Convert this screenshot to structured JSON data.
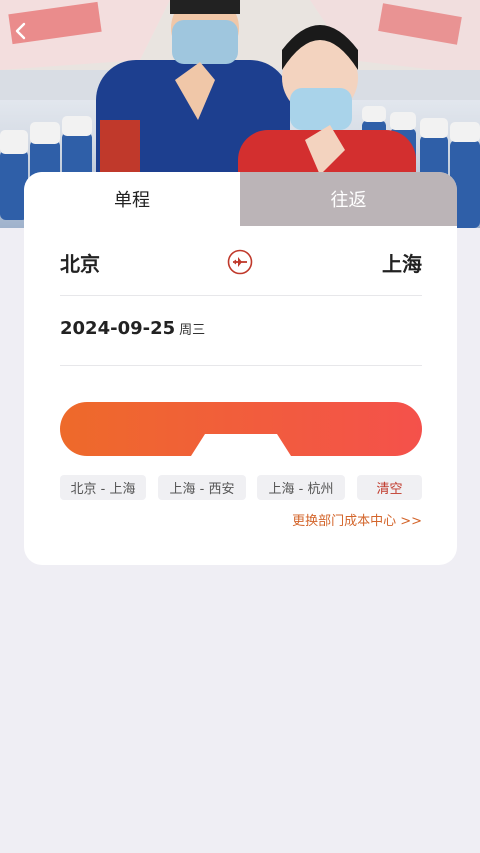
{
  "header": {
    "back_icon": "chevron-left-icon"
  },
  "tabs": [
    {
      "label": "单程",
      "active": true
    },
    {
      "label": "往返",
      "active": false
    }
  ],
  "route": {
    "from": "北京",
    "to": "上海",
    "swap_icon": "plane-swap-icon"
  },
  "date": {
    "value": "2024-09-25",
    "weekday": "周三"
  },
  "history": {
    "items": [
      "北京 - 上海",
      "上海 - 西安",
      "上海 - 杭州"
    ],
    "clear_label": "清空"
  },
  "cost_center_link": "更换部门成本中心 >>",
  "colors": {
    "accent": "#ee6a2a",
    "link": "#d3652b",
    "clear": "#c0392b"
  }
}
